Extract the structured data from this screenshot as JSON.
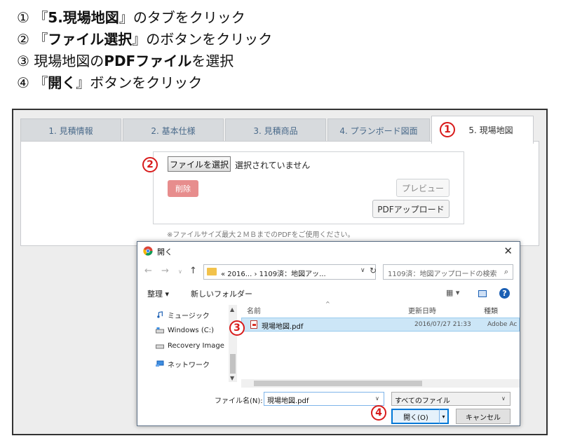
{
  "instructions": [
    {
      "num": "①",
      "open": "『",
      "bold": "5.現場地図",
      "close": "』",
      "rest": "のタブをクリック"
    },
    {
      "num": "②",
      "open": "『",
      "bold": "ファイル選択",
      "close": "』",
      "rest": "のボタンをクリック"
    },
    {
      "num": "③",
      "open": "",
      "bold_prefix": "現場地図の",
      "bold": "PDFファイル",
      "close": "",
      "rest": "を選択"
    },
    {
      "num": "④",
      "open": "『",
      "bold": "開く",
      "close": "』",
      "rest": "ボタンをクリック"
    }
  ],
  "tabs": [
    {
      "label": "1. 見積情報"
    },
    {
      "label": "2. 基本仕様"
    },
    {
      "label": "3. 見積商品"
    },
    {
      "label": "4. プランボード図面"
    },
    {
      "label": "5. 現場地図"
    }
  ],
  "upload": {
    "file_button": "ファイルを選択",
    "no_file": "選択されていません",
    "delete_button": "削除",
    "preview_button": "プレビュー",
    "pdf_upload_button": "PDFアップロード",
    "note": "※ファイルサイズ最大２ＭＢまでのPDFをご使用ください。"
  },
  "markers": {
    "m1": "1",
    "m2": "2",
    "m3": "3",
    "m4": "4"
  },
  "dialog": {
    "title": "開く",
    "close": "✕",
    "nav_back": "←",
    "nav_forward": "→",
    "nav_down": "∨",
    "nav_up": "↑",
    "address": "« 2016... › 1109済：地図アッ...",
    "address_chevron": "∨",
    "refresh": "↻",
    "search_placeholder": "1109済：地図アップロードの検索",
    "search_icon": "⌕",
    "organize": "整理 ▾",
    "new_folder": "新しいフォルダー",
    "view_icon": "▦ ▾",
    "help": "?",
    "nav_items": [
      {
        "label": "ミュージック",
        "icon": "music-note-icon"
      },
      {
        "label": "Windows (C:)",
        "icon": "drive-icon"
      },
      {
        "label": "Recovery Image",
        "icon": "drive-icon"
      },
      {
        "label": "ネットワーク",
        "icon": "network-icon"
      }
    ],
    "columns": {
      "name": "名前",
      "modified": "更新日時",
      "type": "種類"
    },
    "sort_caret": "^",
    "file": {
      "name": "現場地図.pdf",
      "modified": "2016/07/27 21:33",
      "type": "Adobe Ac"
    },
    "filename_label": "ファイル名(N):",
    "filename_value": "現場地図.pdf",
    "filetype_value": "すべてのファイル",
    "dropdown_arrow": "∨",
    "open_button": "開く(O)",
    "open_split": "▾",
    "cancel_button": "キャンセル"
  },
  "colors": {
    "marker": "#d81b1b",
    "accent": "#0078d7",
    "delete": "#e78d8d"
  }
}
